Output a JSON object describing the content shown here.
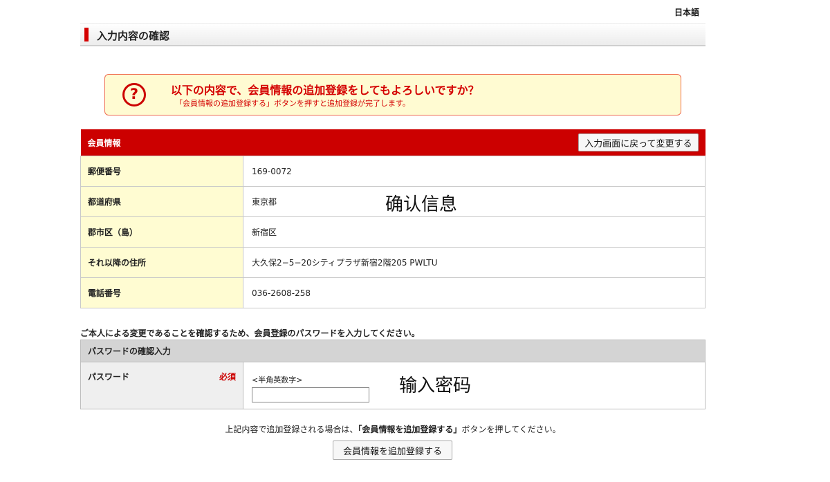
{
  "header": {
    "language": "日本語",
    "page_title": "入力内容の確認"
  },
  "confirm": {
    "icon": "question-circle-icon",
    "main_text": "以下の内容で、会員情報の追加登録をしてもよろしいですか？",
    "sub_text": "「会員情報の追加登録する」ボタンを押すと追加登録が完了します。"
  },
  "member_info": {
    "title": "会員情報",
    "back_button": "入力画面に戻って変更する",
    "rows": [
      {
        "label": "郵便番号",
        "value": "169-0072"
      },
      {
        "label": "都道府県",
        "value": "東京都"
      },
      {
        "label": "郡市区（島）",
        "value": "新宿区"
      },
      {
        "label": "それ以降の住所",
        "value": "大久保2−5−20シティプラザ新宿2階205 PWLTU"
      },
      {
        "label": "電話番号",
        "value": "036-2608-258"
      }
    ]
  },
  "password_section": {
    "note": "ご本人による変更であることを確認するため、会員登録のパスワードを入力してください。",
    "title": "パスワードの確認入力",
    "label": "パスワード",
    "required": "必須",
    "hint": "<半角英数字>",
    "value": ""
  },
  "annotations": {
    "confirm_info": "确认信息",
    "enter_password": "输入密码"
  },
  "footer": {
    "note_before": "上記内容で追加登録される場合は、",
    "note_bold": "「会員情報を追加登録する」",
    "note_after": "ボタンを押してください。",
    "submit_button": "会員情報を追加登録する"
  },
  "colors": {
    "accent": "#cc0000",
    "label_bg": "#fffcd2",
    "confirm_bg": "#fffbd2",
    "confirm_border": "#ef6b4f"
  }
}
